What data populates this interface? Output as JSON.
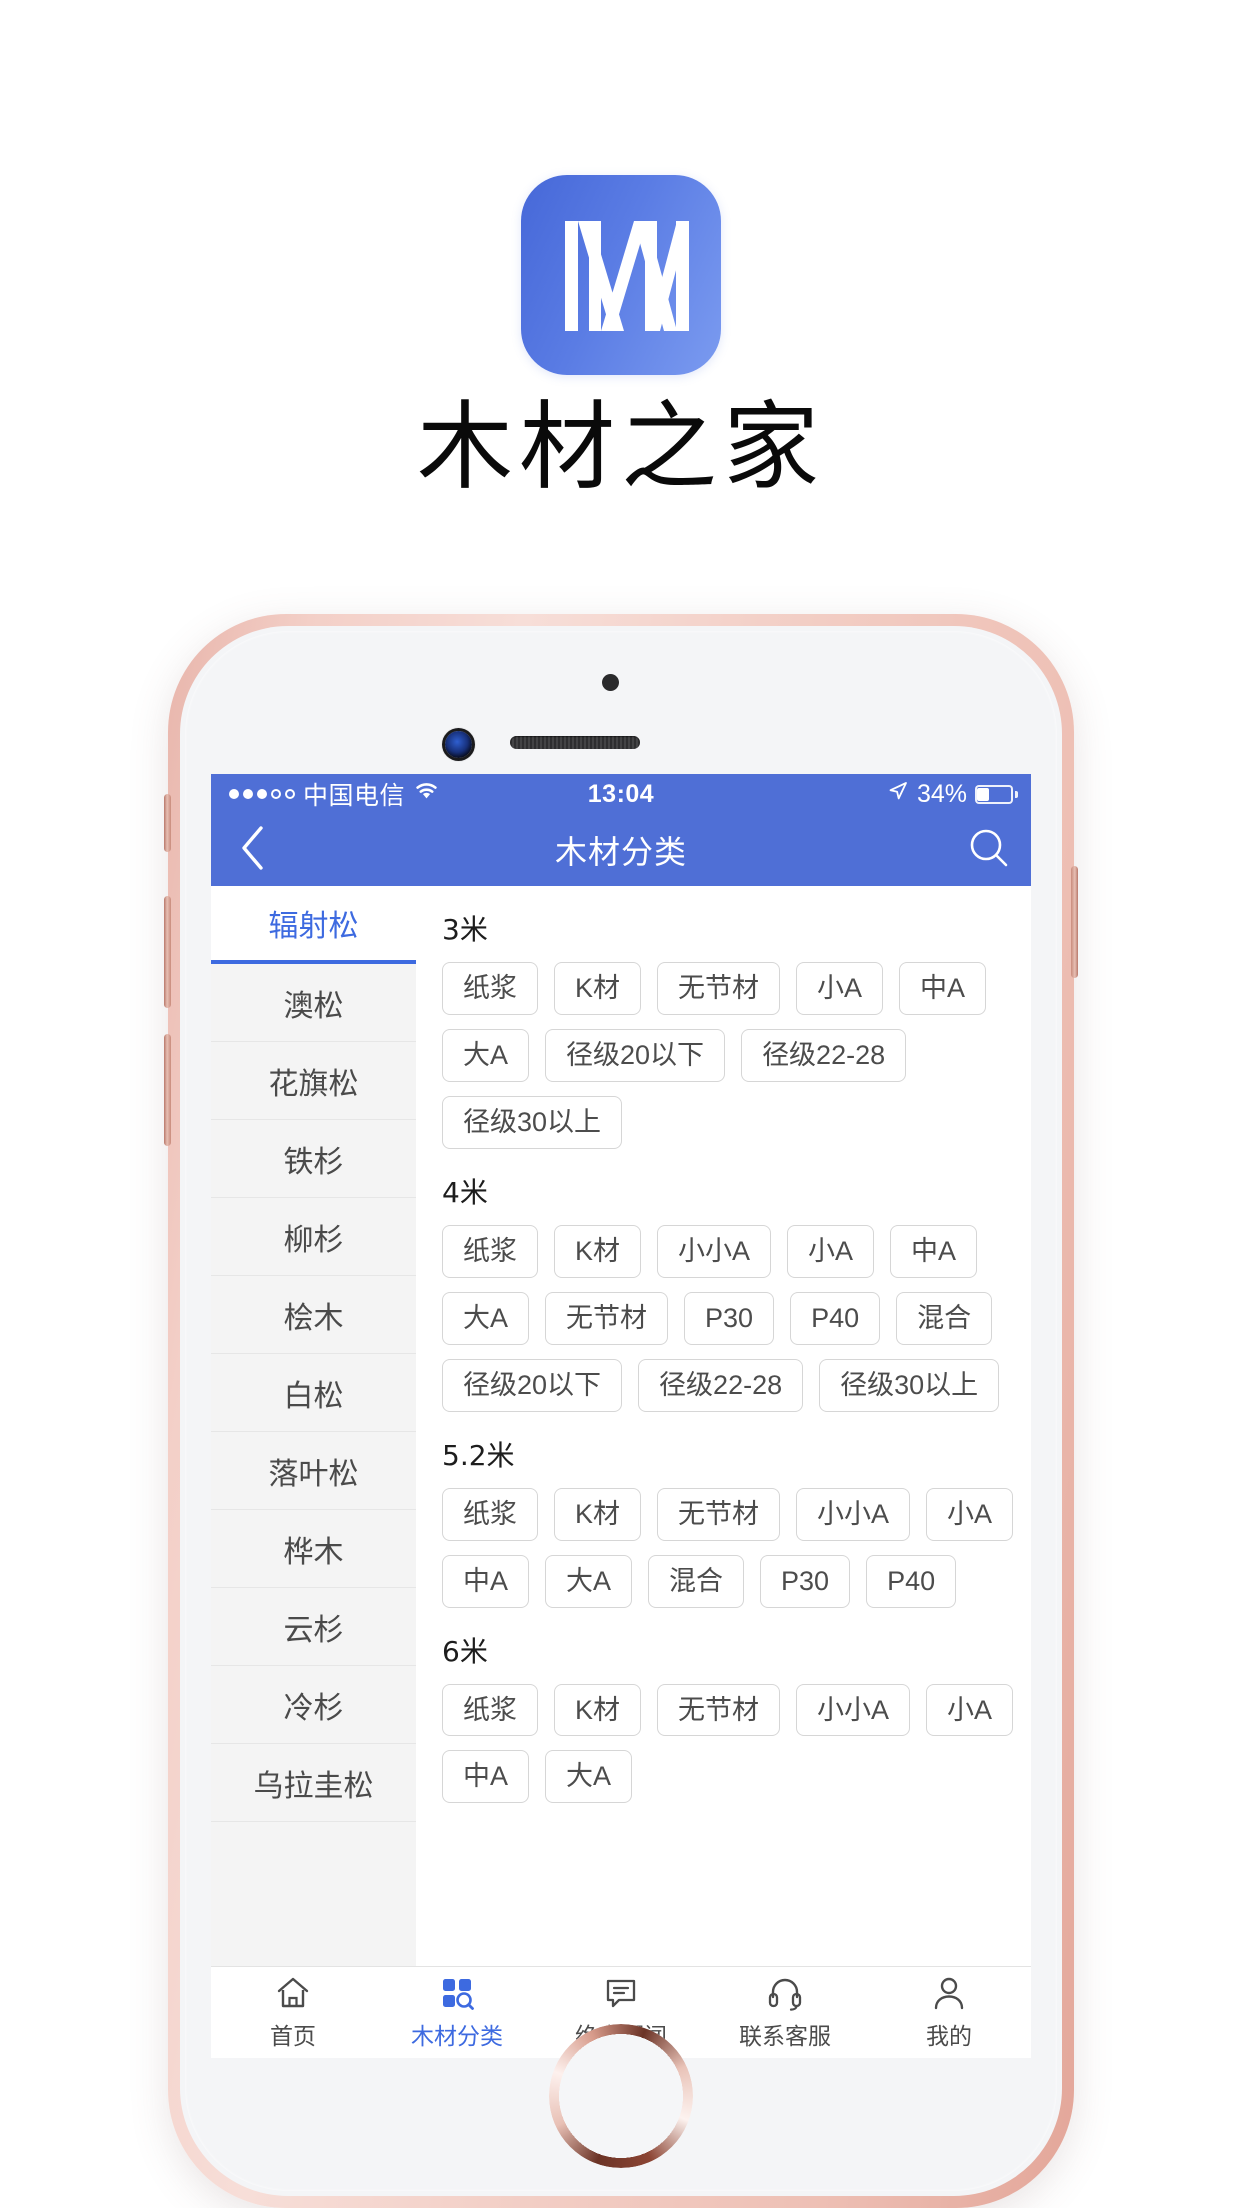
{
  "brand": {
    "logo_icon": "app-logo-m-icon",
    "title": "木材之家",
    "logo_color": "#4f6fd6"
  },
  "phone": {
    "frame_color": "#edc4b9",
    "home_button": "home-button"
  },
  "status_bar": {
    "carrier": "中国电信",
    "wifi_icon": "wifi-icon",
    "time": "13:04",
    "location_icon": "location-arrow-icon",
    "battery_percent": "34%",
    "battery_icon": "battery-icon"
  },
  "nav_bar": {
    "back_icon": "chevron-left-icon",
    "title": "木材分类",
    "search_icon": "search-icon",
    "bg_color": "#4f6fd6"
  },
  "sidebar": {
    "active_index": 0,
    "active_color": "#3d6ae0",
    "items": [
      {
        "label": "辐射松"
      },
      {
        "label": "澳松"
      },
      {
        "label": "花旗松"
      },
      {
        "label": "铁杉"
      },
      {
        "label": "柳杉"
      },
      {
        "label": "桧木"
      },
      {
        "label": "白松"
      },
      {
        "label": "落叶松"
      },
      {
        "label": "桦木"
      },
      {
        "label": "云杉"
      },
      {
        "label": "冷杉"
      },
      {
        "label": "乌拉圭松"
      }
    ]
  },
  "panel": {
    "sections": [
      {
        "title": "3米",
        "tags": [
          "纸浆",
          "K材",
          "无节材",
          "小A",
          "中A",
          "大A",
          "径级20以下",
          "径级22-28",
          "径级30以上"
        ]
      },
      {
        "title": "4米",
        "tags": [
          "纸浆",
          "K材",
          "小小A",
          "小A",
          "中A",
          "大A",
          "无节材",
          "P30",
          "P40",
          "混合",
          "径级20以下",
          "径级22-28",
          "径级30以上"
        ]
      },
      {
        "title": "5.2米",
        "tags": [
          "纸浆",
          "K材",
          "无节材",
          "小小A",
          "小A",
          "中A",
          "大A",
          "混合",
          "P30",
          "P40"
        ]
      },
      {
        "title": "6米",
        "tags": [
          "纸浆",
          "K材",
          "无节材",
          "小小A",
          "小A",
          "中A",
          "大A"
        ]
      }
    ]
  },
  "tab_bar": {
    "active_index": 1,
    "active_color": "#3d6ae0",
    "items": [
      {
        "label": "首页",
        "icon": "home-icon"
      },
      {
        "label": "木材分类",
        "icon": "grid-search-icon"
      },
      {
        "label": "绝密要闻",
        "icon": "message-icon"
      },
      {
        "label": "联系客服",
        "icon": "headset-icon"
      },
      {
        "label": "我的",
        "icon": "person-icon"
      }
    ]
  }
}
